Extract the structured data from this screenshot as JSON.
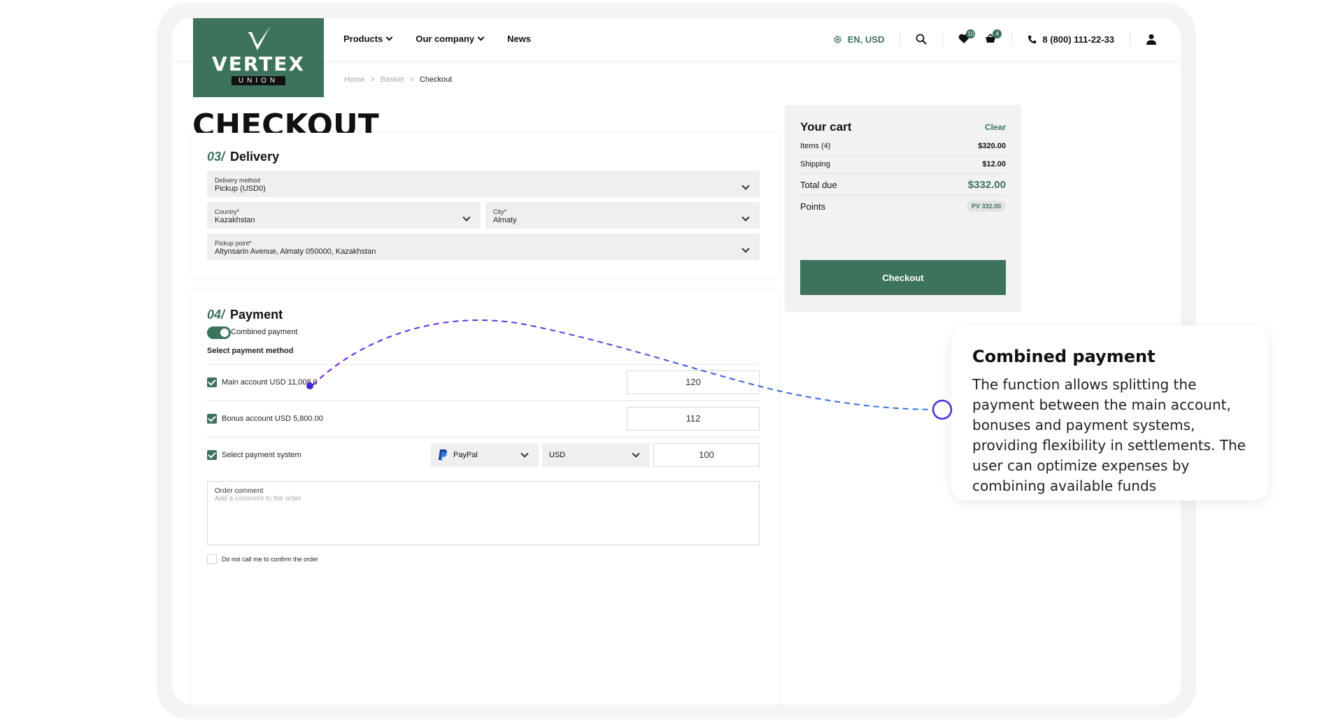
{
  "logo": {
    "word": "VERTEX",
    "sub": "UNION"
  },
  "nav": [
    {
      "label": "Products",
      "has_dropdown": true
    },
    {
      "label": "Our company",
      "has_dropdown": true
    },
    {
      "label": "News",
      "has_dropdown": false
    }
  ],
  "header": {
    "locale": "EN, USD",
    "wishlist_count": "10",
    "basket_count": "4",
    "phone": "8 (800) 111-22-33",
    "icons": [
      "gear-icon",
      "search-icon",
      "heart-icon",
      "basket-icon",
      "phone-icon",
      "user-icon"
    ]
  },
  "breadcrumb": {
    "home": "Home",
    "basket": "Basket",
    "current": "Checkout",
    "separator": ">"
  },
  "page_title": "CHECKOUT",
  "delivery": {
    "number": "03/",
    "title": "Delivery",
    "method_label": "Delivery method",
    "method_value": "Pickup (USD0)",
    "country_label": "Country*",
    "country_value": "Kazakhstan",
    "city_label": "City*",
    "city_value": "Almaty",
    "pickup_label": "Pickup point*",
    "pickup_value": "Altynsarin Avenue, Almaty 050000, Kazakhstan"
  },
  "payment": {
    "number": "04/",
    "title": "Payment",
    "combined_label": "Combined payment",
    "combined_on": true,
    "select_method_label": "Select payment method",
    "rows": [
      {
        "label": "Main account USD 11,008.0",
        "checked": true,
        "amount": "120"
      },
      {
        "label": "Bonus account USD 5,800.00",
        "checked": true,
        "amount": "112"
      },
      {
        "label": "Select payment system",
        "checked": true,
        "amount": "100",
        "system": "PayPal",
        "currency": "USD"
      }
    ],
    "comment_label": "Order comment",
    "comment_placeholder": "Add a comment to the order",
    "no_call_label": "Do not call me to confirm the order"
  },
  "cart": {
    "title": "Your cart",
    "clear": "Clear",
    "items_label": "Items (4)",
    "items_value": "$320.00",
    "shipping_label": "Shipping",
    "shipping_value": "$12.00",
    "total_label": "Total due",
    "total_value": "$332.00",
    "points_label": "Points",
    "points_value": "PV 332.00",
    "checkout": "Checkout"
  },
  "callout": {
    "title": "Combined payment",
    "text": "The function allows splitting the payment between the main account, bonuses and payment systems, providing flexibility in settlements. The user can optimize expenses by combining available funds"
  },
  "colors": {
    "brand": "#3d735b",
    "annotation_start": "#6a1fd6",
    "annotation_end": "#2a7ae2"
  }
}
